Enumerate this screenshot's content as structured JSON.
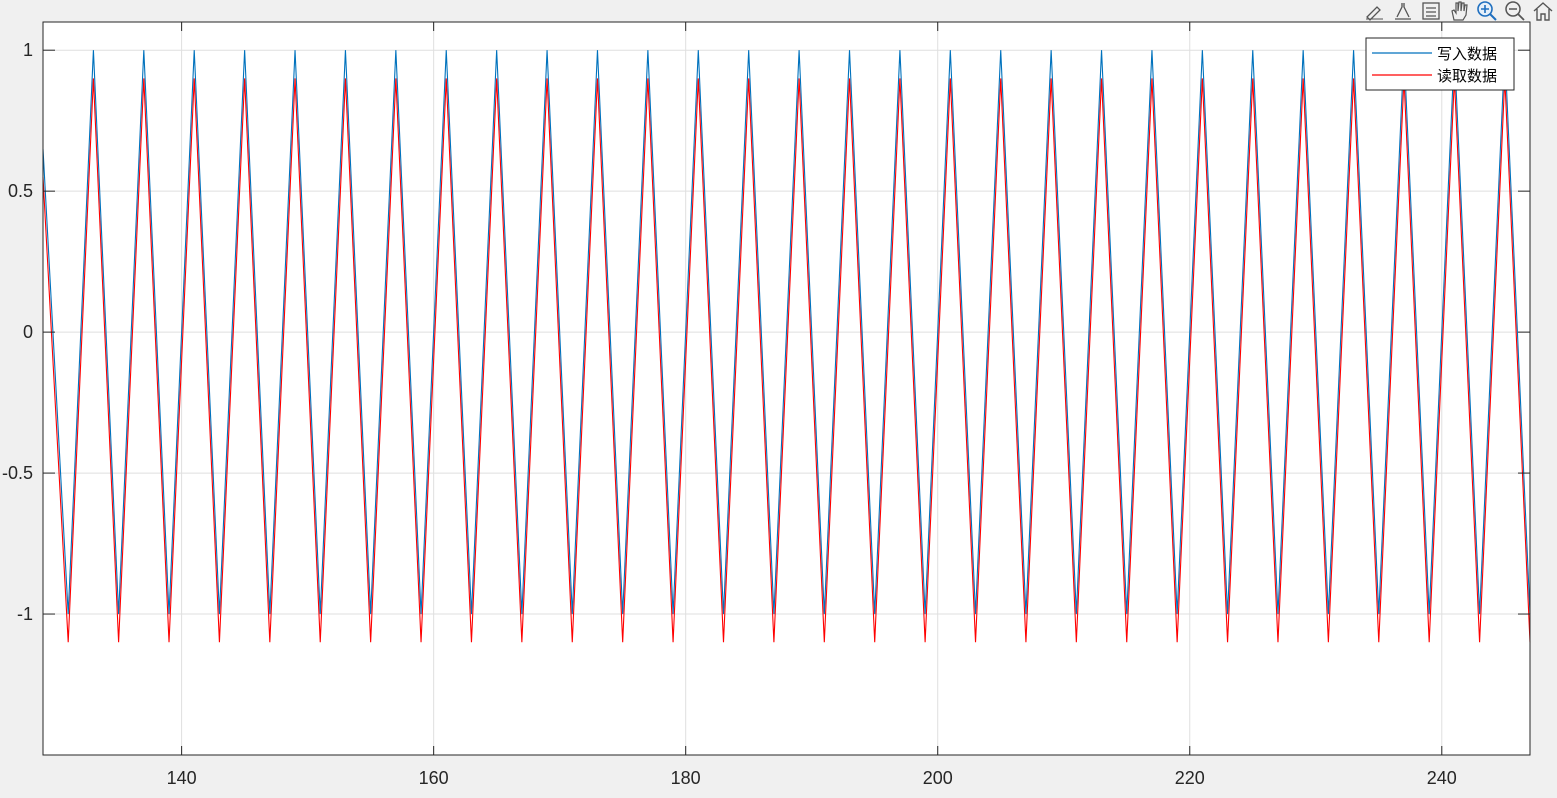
{
  "toolbar": {
    "icons": [
      "brush-icon",
      "data-tips-icon",
      "legend-icon",
      "pan-hand-icon",
      "zoom-in-icon",
      "zoom-out-icon",
      "home-icon"
    ]
  },
  "chart_data": {
    "type": "line",
    "title": "",
    "xlabel": "",
    "ylabel": "",
    "xlim": [
      129,
      247
    ],
    "ylim": [
      -1.5,
      1.1
    ],
    "xticks": [
      140,
      160,
      180,
      200,
      220,
      240
    ],
    "yticks": [
      1,
      0.5,
      0,
      -0.5,
      -1
    ],
    "ytick_labels": [
      "1",
      "0.5",
      "0",
      "-0.5",
      "-1"
    ],
    "grid": true,
    "legend_position": "top-right",
    "series": [
      {
        "name": "写入数据",
        "color": "#0072BD",
        "waveform": "triangle",
        "period": 4,
        "x": [
          129,
          131,
          133,
          135,
          137,
          139,
          141,
          143,
          145,
          147,
          149,
          151,
          153,
          155,
          157,
          159,
          161,
          163,
          165,
          167,
          169,
          171,
          173,
          175,
          177,
          179,
          181,
          183,
          185,
          187,
          189,
          191,
          193,
          195,
          197,
          199,
          201,
          203,
          205,
          207,
          209,
          211,
          213,
          215,
          217,
          219,
          221,
          223,
          225,
          227,
          229,
          231,
          233,
          235,
          237,
          239,
          241,
          243,
          245,
          247
        ],
        "y": [
          0.65,
          -1,
          1,
          -1,
          1,
          -1,
          1,
          -1,
          1,
          -1,
          1,
          -1,
          1,
          -1,
          1,
          -1,
          1,
          -1,
          1,
          -1,
          1,
          -1,
          1,
          -1,
          1,
          -1,
          1,
          -1,
          1,
          -1,
          1,
          -1,
          1,
          -1,
          1,
          -1,
          1,
          -1,
          1,
          -1,
          1,
          -1,
          1,
          -1,
          1,
          -1,
          1,
          -1,
          1,
          -1,
          1,
          -1,
          1,
          -1,
          1,
          -1,
          1,
          -1,
          1,
          -1
        ]
      },
      {
        "name": "读取数据",
        "color": "#FF0000",
        "waveform": "triangle",
        "period": 4,
        "x": [
          129,
          131,
          133,
          135,
          137,
          139,
          141,
          143,
          145,
          147,
          149,
          151,
          153,
          155,
          157,
          159,
          161,
          163,
          165,
          167,
          169,
          171,
          173,
          175,
          177,
          179,
          181,
          183,
          185,
          187,
          189,
          191,
          193,
          195,
          197,
          199,
          201,
          203,
          205,
          207,
          209,
          211,
          213,
          215,
          217,
          219,
          221,
          223,
          225,
          227,
          229,
          231,
          233,
          235,
          237,
          239,
          241,
          243,
          245,
          247
        ],
        "y": [
          0.55,
          -1.1,
          0.9,
          -1.1,
          0.9,
          -1.1,
          0.9,
          -1.1,
          0.9,
          -1.1,
          0.9,
          -1.1,
          0.9,
          -1.1,
          0.9,
          -1.1,
          0.9,
          -1.1,
          0.9,
          -1.1,
          0.9,
          -1.1,
          0.9,
          -1.1,
          0.9,
          -1.1,
          0.9,
          -1.1,
          0.9,
          -1.1,
          0.9,
          -1.1,
          0.9,
          -1.1,
          0.9,
          -1.1,
          0.9,
          -1.1,
          0.9,
          -1.1,
          0.9,
          -1.1,
          0.9,
          -1.1,
          0.9,
          -1.1,
          0.9,
          -1.1,
          0.9,
          -1.1,
          0.9,
          -1.1,
          0.9,
          -1.1,
          0.9,
          -1.1,
          0.9,
          -1.1,
          0.9,
          -1.1
        ]
      }
    ]
  }
}
